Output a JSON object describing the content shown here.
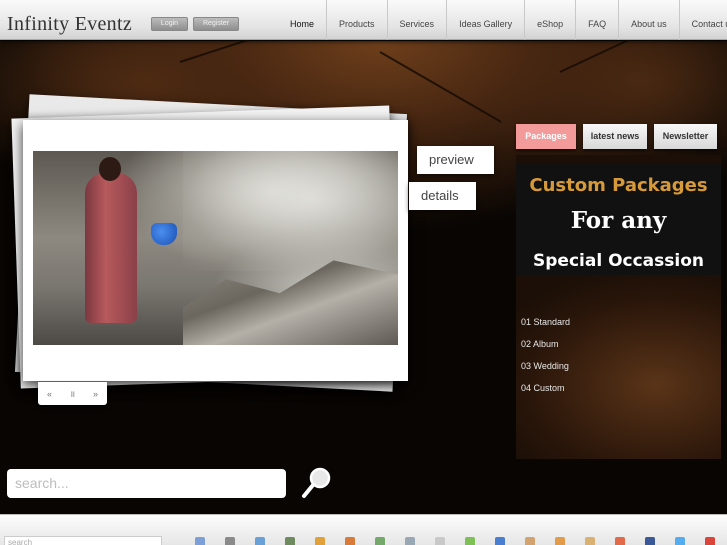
{
  "header": {
    "logo": "Infinity Eventz",
    "login_label": "Login",
    "register_label": "Register",
    "nav": [
      "Home",
      "Products",
      "Services",
      "Ideas Gallery",
      "eShop",
      "FAQ",
      "About us",
      "Contact us"
    ]
  },
  "slideshow": {
    "preview_label": "preview",
    "details_label": "details",
    "controls": {
      "prev": "«",
      "pause": "॥",
      "next": "»"
    }
  },
  "panel": {
    "tabs": [
      "Packages",
      "latest news",
      "Newsletter"
    ],
    "active_tab_color": "#f39b9b",
    "promo": {
      "line1": "Custom Packages",
      "line2": "For any",
      "line3": "Special Occassion"
    },
    "packages": [
      "01 Standard",
      "02 Album",
      "03 Wedding",
      "04 Custom"
    ]
  },
  "search": {
    "placeholder": "search..."
  },
  "bottom_bar": {
    "search_placeholder": "search"
  }
}
